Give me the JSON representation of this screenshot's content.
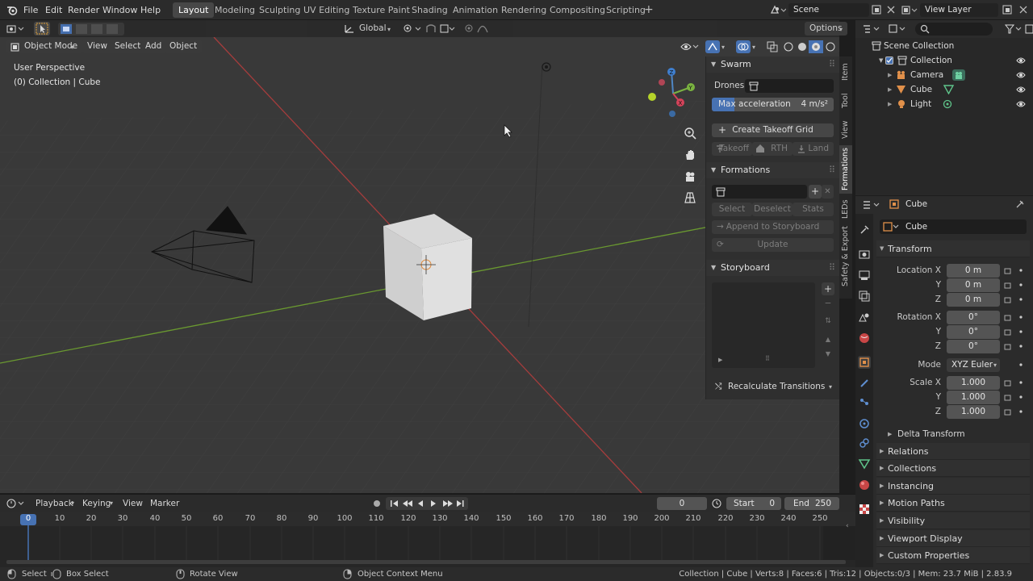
{
  "topbar": {
    "menus": [
      "File",
      "Edit",
      "Render",
      "Window",
      "Help"
    ],
    "workspaces": [
      "Layout",
      "Modeling",
      "Sculpting",
      "UV Editing",
      "Texture Paint",
      "Shading",
      "Animation",
      "Rendering",
      "Compositing",
      "Scripting"
    ],
    "active_workspace": "Layout",
    "scene": "Scene",
    "view_layer": "View Layer"
  },
  "viewport": {
    "mode": "Object Mode",
    "menus": [
      "View",
      "Select",
      "Add",
      "Object"
    ],
    "orientation": "Global",
    "options": "Options",
    "overlay_title": "User Perspective",
    "overlay_subtitle": "(0) Collection | Cube"
  },
  "npanel": {
    "swarm": {
      "title": "Swarm",
      "drones_label": "Drones:",
      "max_accel_label": "Max acceleration",
      "max_accel_value": "4 m/s²",
      "create_grid": "Create Takeoff Grid",
      "takeoff": "Takeoff",
      "rth": "RTH",
      "land": "Land"
    },
    "formations": {
      "title": "Formations",
      "select": "Select",
      "deselect": "Deselect",
      "stats": "Stats",
      "append": "Append to Storyboard",
      "update": "Update"
    },
    "storyboard": {
      "title": "Storyboard",
      "recalc": "Recalculate Transitions"
    },
    "tabs": [
      "Item",
      "Tool",
      "View",
      "Formations",
      "LEDs",
      "Safety & Export"
    ],
    "active_tab": "Formations"
  },
  "outliner": {
    "root": "Scene Collection",
    "collection": "Collection",
    "items": [
      "Camera",
      "Cube",
      "Light"
    ]
  },
  "properties": {
    "object_name_header": "Cube",
    "object_name": "Cube",
    "transform_title": "Transform",
    "location_label": "Location X",
    "rotation_label": "Rotation X",
    "scale_label": "Scale X",
    "y_label": "Y",
    "z_label": "Z",
    "mode_label": "Mode",
    "mode_value": "XYZ Euler",
    "location": [
      "0 m",
      "0 m",
      "0 m"
    ],
    "rotation": [
      "0°",
      "0°",
      "0°"
    ],
    "scale": [
      "1.000",
      "1.000",
      "1.000"
    ],
    "delta_transform": "Delta Transform",
    "sections": [
      "Relations",
      "Collections",
      "Instancing",
      "Motion Paths",
      "Visibility",
      "Viewport Display",
      "Custom Properties"
    ]
  },
  "timeline": {
    "menus": [
      "Playback",
      "Keying",
      "View",
      "Marker"
    ],
    "current_frame": "0",
    "start_label": "Start",
    "start_value": "0",
    "end_label": "End",
    "end_value": "250",
    "ticks": [
      "0",
      "10",
      "20",
      "30",
      "40",
      "50",
      "60",
      "70",
      "80",
      "90",
      "100",
      "110",
      "120",
      "130",
      "140",
      "150",
      "160",
      "170",
      "180",
      "190",
      "200",
      "210",
      "220",
      "230",
      "240",
      "250"
    ]
  },
  "statusbar": {
    "select": "Select",
    "box_select": "Box Select",
    "rotate_view": "Rotate View",
    "context_menu": "Object Context Menu",
    "stats": "Collection | Cube | Verts:8 | Faces:6 | Tris:12 | Objects:0/3 | Mem: 23.7 MiB | 2.83.9"
  },
  "colors": {
    "accent": "#4772b3",
    "x_axis": "#b0403f",
    "y_axis": "#6c9a32",
    "object_orange": "#e1904a",
    "data_green": "#5fc48a"
  }
}
